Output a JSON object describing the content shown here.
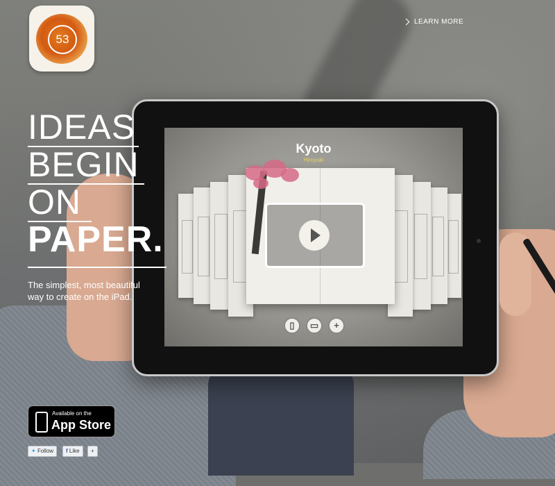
{
  "header": {
    "app_icon_number": "53",
    "learn_more": "LEARN MORE"
  },
  "hero": {
    "headline_lines": [
      "IDEAS",
      "BEGIN",
      "ON",
      "PAPER."
    ],
    "tagline": "The simplest, most beautiful way to create on the iPad."
  },
  "tablet": {
    "book_title": "Kyoto",
    "book_subtitle": "Hiroyuki",
    "tools": [
      "trash-icon",
      "share-icon",
      "add-icon"
    ]
  },
  "footer": {
    "appstore_small": "Available on the",
    "appstore_big": "App Store",
    "follow_label": "Follow",
    "like_label": "Like",
    "share_label": "+"
  },
  "colors": {
    "accent_orange": "#d35a12",
    "subtitle_yellow": "#e7d266"
  }
}
